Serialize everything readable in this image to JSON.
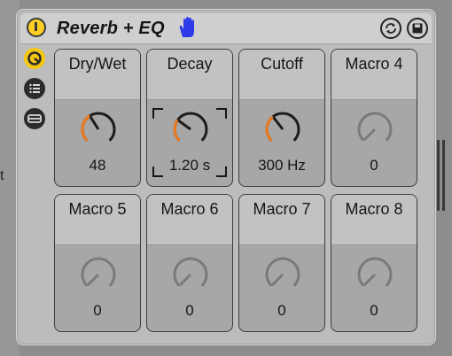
{
  "device": {
    "title": "Reverb + EQ",
    "power_state": "on"
  },
  "icons": {
    "power": "power-icon",
    "hand": "hand-icon",
    "sync": "sync-icon",
    "save": "save-icon",
    "macro": "macro-view-icon",
    "list": "chain-list-icon",
    "devices": "devices-view-icon"
  },
  "colors": {
    "accent": "#f5c612",
    "knob_active": "#ee7a1e",
    "hand": "#2f3be8"
  },
  "left_fragment": "t",
  "macros": [
    {
      "label": "Dry/Wet",
      "value": "48",
      "level": 0.38,
      "active": true,
      "selected": false
    },
    {
      "label": "Decay",
      "value": "1.20 s",
      "level": 0.3,
      "active": true,
      "selected": true
    },
    {
      "label": "Cutoff",
      "value": "300 Hz",
      "level": 0.36,
      "active": true,
      "selected": false
    },
    {
      "label": "Macro 4",
      "value": "0",
      "level": 0.0,
      "active": false,
      "selected": false
    },
    {
      "label": "Macro 5",
      "value": "0",
      "level": 0.0,
      "active": false,
      "selected": false
    },
    {
      "label": "Macro 6",
      "value": "0",
      "level": 0.0,
      "active": false,
      "selected": false
    },
    {
      "label": "Macro 7",
      "value": "0",
      "level": 0.0,
      "active": false,
      "selected": false
    },
    {
      "label": "Macro 8",
      "value": "0",
      "level": 0.0,
      "active": false,
      "selected": false
    }
  ]
}
